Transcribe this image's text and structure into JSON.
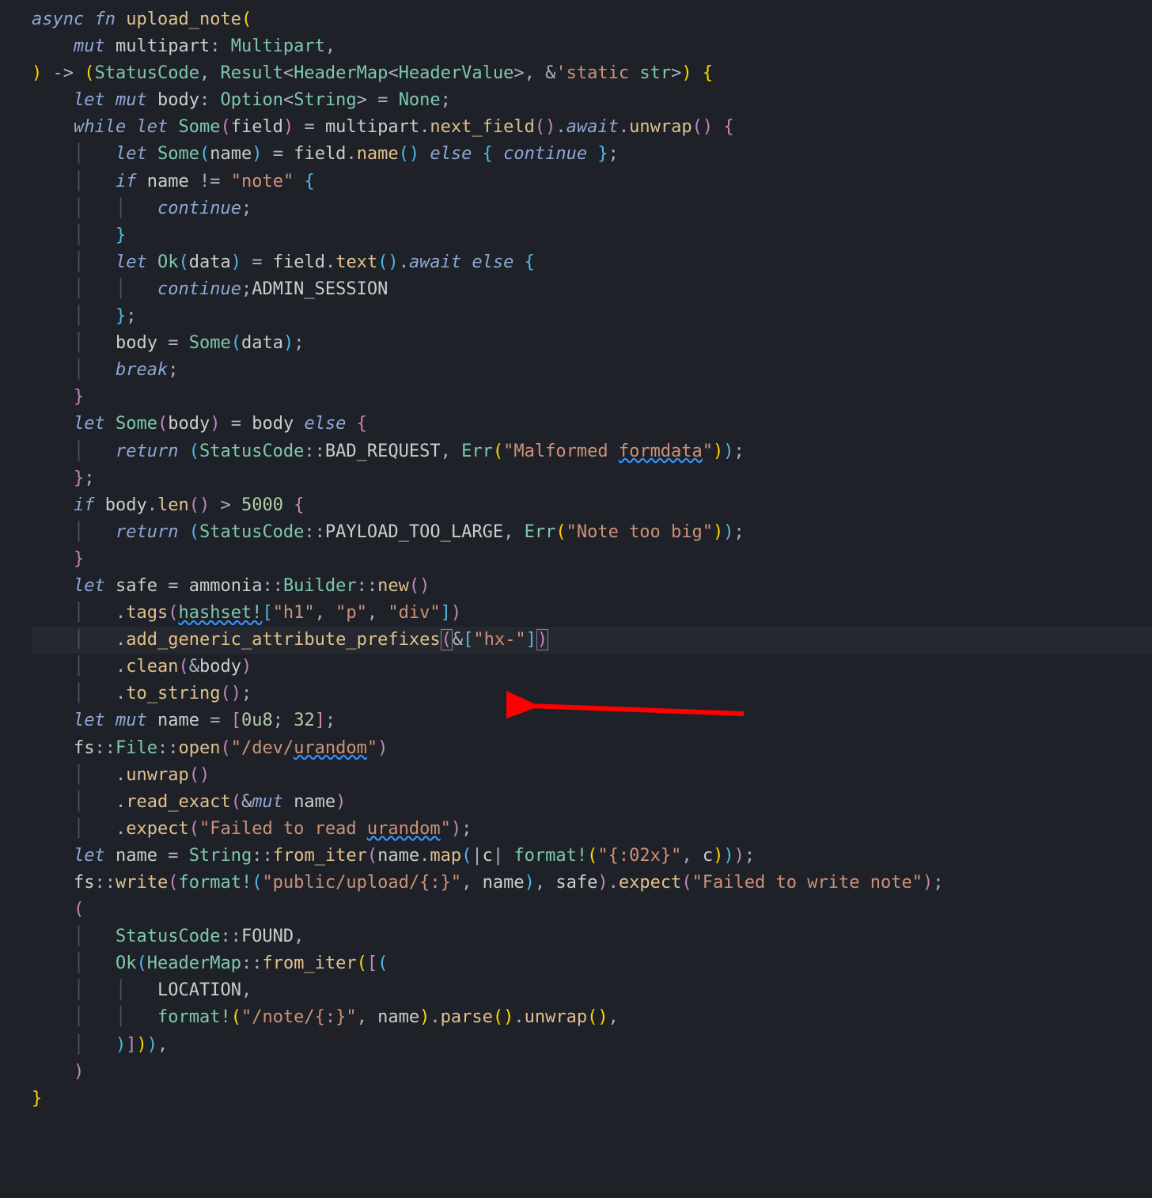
{
  "lines": {
    "l1": {
      "async": "async",
      "fn": "fn",
      "name": "upload_note"
    },
    "l2": {
      "mut": "mut",
      "param": "multipart",
      "type": "Multipart"
    },
    "l3": {
      "StatusCode": "StatusCode",
      "Result": "Result",
      "HeaderMap": "HeaderMap",
      "HeaderValue": "HeaderValue",
      "static": "'static",
      "str": "str"
    },
    "l4": {
      "let": "let",
      "mut": "mut",
      "body": "body",
      "Option": "Option",
      "String": "String",
      "None": "None"
    },
    "l5": {
      "while": "while",
      "let": "let",
      "Some": "Some",
      "field": "field",
      "multipart": "multipart",
      "next_field": "next_field",
      "await": "await",
      "unwrap": "unwrap"
    },
    "l6": {
      "let": "let",
      "Some": "Some",
      "name": "name",
      "field": "field",
      "namefn": "name",
      "else": "else",
      "continue": "continue"
    },
    "l7": {
      "if": "if",
      "name": "name",
      "note": "\"note\""
    },
    "l8": {
      "continue": "continue"
    },
    "l10": {
      "let": "let",
      "Ok": "Ok",
      "data": "data",
      "field": "field",
      "text": "text",
      "await": "await",
      "else": "else"
    },
    "l11": {
      "continue": "continue",
      "ADMIN_SESSION": "ADMIN_SESSION"
    },
    "l13": {
      "body": "body",
      "Some": "Some",
      "data": "data"
    },
    "l14": {
      "break": "break"
    },
    "l16": {
      "let": "let",
      "Some": "Some",
      "body": "body",
      "body2": "body",
      "else": "else"
    },
    "l17": {
      "return": "return",
      "StatusCode": "StatusCode",
      "BAD_REQUEST": "BAD_REQUEST",
      "Err": "Err",
      "msg": "\"Malformed ",
      "formdata": "formdata",
      "msgEnd": "\""
    },
    "l19": {
      "if": "if",
      "body": "body",
      "len": "len",
      "num": "5000"
    },
    "l20": {
      "return": "return",
      "StatusCode": "StatusCode",
      "PAYLOAD_TOO_LARGE": "PAYLOAD_TOO_LARGE",
      "Err": "Err",
      "msg": "\"Note too big\""
    },
    "l22": {
      "let": "let",
      "safe": "safe",
      "ammonia": "ammonia",
      "Builder": "Builder",
      "new": "new"
    },
    "l23": {
      "tags": "tags",
      "hashset": "hashset!",
      "h1": "\"h1\"",
      "p": "\"p\"",
      "div": "\"div\""
    },
    "l24": {
      "add_generic": "add_generic_attribute_prefixes",
      "hx": "\"hx-\""
    },
    "l25": {
      "clean": "clean",
      "body": "body"
    },
    "l26": {
      "to_string": "to_string"
    },
    "l27": {
      "let": "let",
      "mut": "mut",
      "name": "name",
      "zero": "0u8",
      "size": "32"
    },
    "l28": {
      "fs": "fs",
      "File": "File",
      "open": "open",
      "path": "\"/dev/",
      "urandom": "urandom",
      "pathEnd": "\""
    },
    "l29": {
      "unwrap": "unwrap"
    },
    "l30": {
      "read_exact": "read_exact",
      "mut": "mut",
      "name": "name"
    },
    "l31": {
      "expect": "expect",
      "msg": "\"Failed to read ",
      "urandom": "urandom",
      "msgEnd": "\""
    },
    "l32": {
      "let": "let",
      "name": "name",
      "String": "String",
      "from_iter": "from_iter",
      "name2": "name",
      "map": "map",
      "c": "c",
      "format": "format!",
      "fmt": "\"{:02x}\"",
      "c2": "c"
    },
    "l33": {
      "fs": "fs",
      "write": "write",
      "format": "format!",
      "path": "\"public/upload/{:}\"",
      "name": "name",
      "safe": "safe",
      "expect": "expect",
      "msg": "\"Failed to write note\""
    },
    "l35": {
      "StatusCode": "StatusCode",
      "FOUND": "FOUND"
    },
    "l36": {
      "Ok": "Ok",
      "HeaderMap": "HeaderMap",
      "from_iter": "from_iter"
    },
    "l37": {
      "LOCATION": "LOCATION"
    },
    "l38": {
      "format": "format!",
      "fmt": "\"/note/{:}\"",
      "name": "name",
      "parse": "parse",
      "unwrap": "unwrap"
    }
  },
  "arrow": {
    "label": "red-arrow-annotation",
    "color": "#ff0000"
  }
}
